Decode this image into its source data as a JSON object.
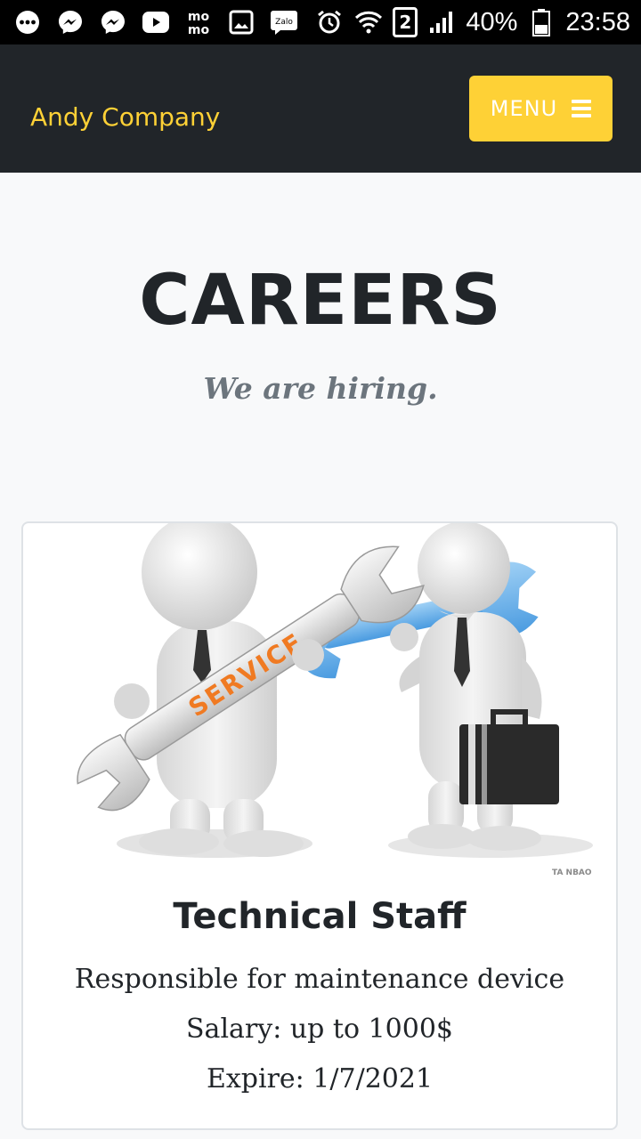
{
  "status_bar": {
    "left_icons": [
      "more-dots-icon",
      "messenger-icon",
      "messenger-icon",
      "youtube-icon",
      "momo-icon",
      "gallery-icon",
      "zalo-icon"
    ],
    "momo_text": "mo mo",
    "zalo_text": "Zalo",
    "sim_slot": "2",
    "battery": "40%",
    "time": "23:58"
  },
  "navbar": {
    "brand": "Andy Company",
    "menu_label": "MENU",
    "accent_color": "#fed136",
    "background_color": "#212529"
  },
  "page": {
    "title": "CAREERS",
    "subtitle": "We are hiring."
  },
  "jobs": [
    {
      "image_label": "SERVICE",
      "watermark": "TA NBAO",
      "title": "Technical Staff",
      "description": "Responsible for maintenance device",
      "salary": "Salary: up to 1000$",
      "expire": "Expire: 1/7/2021"
    }
  ]
}
